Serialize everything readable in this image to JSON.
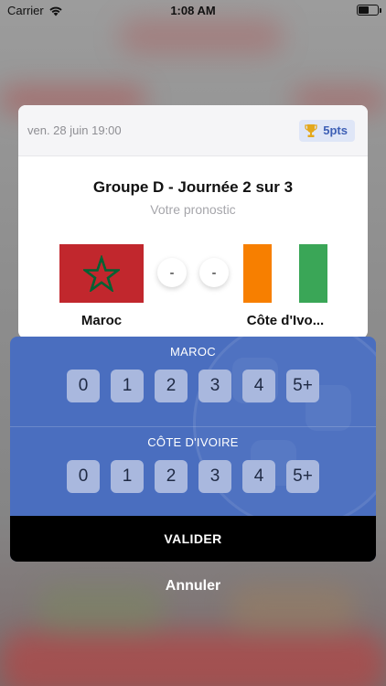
{
  "status_bar": {
    "carrier": "Carrier",
    "time": "1:08 AM",
    "battery_level": 0.55
  },
  "card": {
    "date": "ven. 28 juin 19:00",
    "points_badge": "5pts",
    "title": "Groupe D - Journée 2 sur 3",
    "subtitle": "Votre pronostic",
    "home_team": {
      "name": "Maroc",
      "score": "-"
    },
    "away_team": {
      "name": "Côte d'Ivo...",
      "score": "-"
    }
  },
  "picker": {
    "home_label": "MAROC",
    "away_label": "CÔTE D'IVOIRE",
    "options": [
      "0",
      "1",
      "2",
      "3",
      "4",
      "5+"
    ],
    "validate_label": "VALIDER"
  },
  "cancel_label": "Annuler",
  "colors": {
    "picker_bg": "#4a6ebf",
    "number_button": "#a9b8de",
    "badge_text": "#3d5fb5",
    "badge_bg": "#dfe6f7",
    "morocco_red": "#c1272d",
    "morocco_star": "#006233",
    "ci_orange": "#f77f00",
    "ci_white": "#ffffff",
    "ci_green": "#3aa657"
  },
  "icons": {
    "wifi": "wifi-icon",
    "battery": "battery-icon",
    "trophy": "trophy-icon"
  }
}
